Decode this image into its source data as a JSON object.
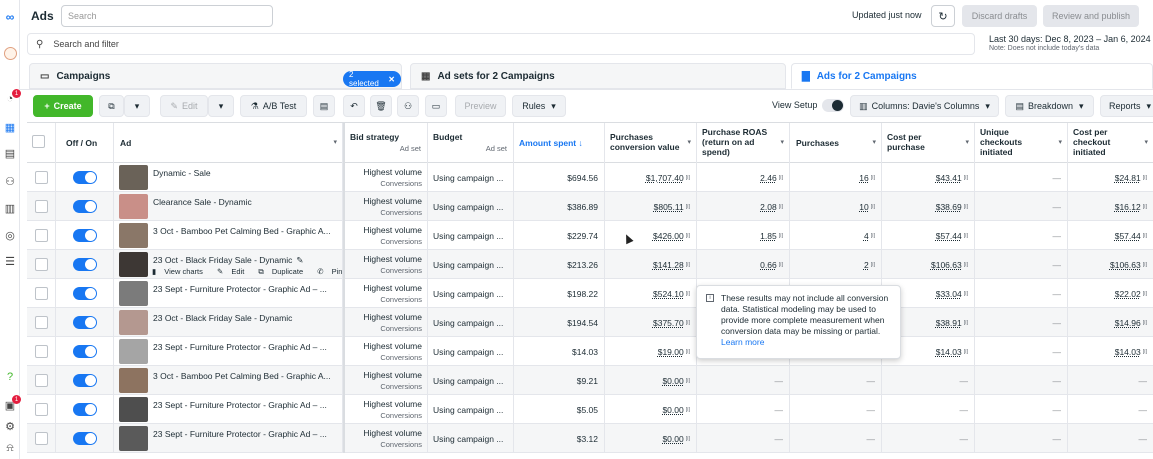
{
  "app": {
    "title": "Ads",
    "search_placeholder": "Search"
  },
  "rail": {
    "badge1": "1",
    "badge2": "1"
  },
  "header": {
    "updated": "Updated just now",
    "discard": "Discard drafts",
    "review": "Review and publish"
  },
  "filter": {
    "placeholder": "Search and filter"
  },
  "daterange": {
    "label": "Last 30 days: Dec 8, 2023 – Jan 6, 2024",
    "note": "Note: Does not include today's data"
  },
  "tabs": {
    "campaigns": "Campaigns",
    "selected_chip": "2 selected",
    "adsets": "Ad sets for 2 Campaigns",
    "ads": "Ads for 2 Campaigns"
  },
  "toolbar": {
    "create": "Create",
    "edit": "Edit",
    "abtest": "A/B Test",
    "preview": "Preview",
    "rules": "Rules",
    "view_setup": "View Setup",
    "columns": "Columns: Davie's Columns",
    "breakdown": "Breakdown",
    "reports": "Reports"
  },
  "columns": {
    "offon": "Off / On",
    "ad": "Ad",
    "bid": "Bid strategy",
    "bid_sub": "Ad set",
    "budget": "Budget",
    "budget_sub": "Ad set",
    "amount": "Amount spent ↓",
    "pcv": "Purchases conversion value",
    "roas": "Purchase ROAS (return on ad spend)",
    "purchases": "Purchases",
    "cpp": "Cost per purchase",
    "uci": "Unique checkouts initiated",
    "cpci": "Cost per checkout initiated"
  },
  "rows": [
    {
      "name": "Dynamic - Sale",
      "bid": "Highest volume",
      "bid_sub": "Conversions",
      "budget": "Using campaign ...",
      "amount": "$694.56",
      "pcv": "$1,707.40",
      "roas": "2.46",
      "purchases": "16",
      "cpp": "$43.41",
      "uci": "—",
      "cpci": "$24.81",
      "thumb": "#6a6258"
    },
    {
      "name": "Clearance Sale - Dynamic",
      "bid": "Highest volume",
      "bid_sub": "Conversions",
      "budget": "Using campaign ...",
      "amount": "$386.89",
      "pcv": "$805.11",
      "roas": "2.08",
      "purchases": "10",
      "cpp": "$38.69",
      "uci": "—",
      "cpci": "$16.12",
      "thumb": "#c98f88"
    },
    {
      "name": "3 Oct - Bamboo Pet Calming Bed - Graphic A...",
      "bid": "Highest volume",
      "bid_sub": "Conversions",
      "budget": "Using campaign ...",
      "amount": "$229.74",
      "pcv": "$426.00",
      "roas": "1.85",
      "purchases": "4",
      "cpp": "$57.44",
      "uci": "—",
      "cpci": "$57.44",
      "thumb": "#8a7768"
    },
    {
      "name": "23 Oct - Black Friday Sale - Dynamic",
      "bid": "Highest volume",
      "bid_sub": "Conversions",
      "budget": "Using campaign ...",
      "amount": "$213.26",
      "pcv": "$141.28",
      "roas": "0.66",
      "purchases": "2",
      "cpp": "$106.63",
      "uci": "—",
      "cpci": "$106.63",
      "thumb": "#3d3734"
    },
    {
      "name": "23 Sept - Furniture Protector - Graphic Ad – ...",
      "bid": "Highest volume",
      "bid_sub": "Conversions",
      "budget": "Using campaign ...",
      "amount": "$198.22",
      "pcv": "$524.10",
      "roas": "",
      "purchases": "",
      "cpp": "$33.04",
      "uci": "—",
      "cpci": "$22.02",
      "thumb": "#7b7b7b"
    },
    {
      "name": "23 Oct - Black Friday Sale - Dynamic",
      "bid": "Highest volume",
      "bid_sub": "Conversions",
      "budget": "Using campaign ...",
      "amount": "$194.54",
      "pcv": "$375.70",
      "roas": "",
      "purchases": "",
      "cpp": "$38.91",
      "uci": "—",
      "cpci": "$14.96",
      "thumb": "#b49890"
    },
    {
      "name": "23 Sept - Furniture Protector - Graphic Ad – ...",
      "bid": "Highest volume",
      "bid_sub": "Conversions",
      "budget": "Using campaign ...",
      "amount": "$14.03",
      "pcv": "$19.00",
      "roas": "",
      "purchases": "",
      "cpp": "$14.03",
      "uci": "—",
      "cpci": "$14.03",
      "thumb": "#a5a5a5"
    },
    {
      "name": "3 Oct - Bamboo Pet Calming Bed - Graphic A...",
      "bid": "Highest volume",
      "bid_sub": "Conversions",
      "budget": "Using campaign ...",
      "amount": "$9.21",
      "pcv": "$0.00",
      "roas": "—",
      "purchases": "—",
      "cpp": "—",
      "uci": "—",
      "cpci": "—",
      "thumb": "#8d7360"
    },
    {
      "name": "23 Sept - Furniture Protector - Graphic Ad – ...",
      "bid": "Highest volume",
      "bid_sub": "Conversions",
      "budget": "Using campaign ...",
      "amount": "$5.05",
      "pcv": "$0.00",
      "roas": "—",
      "purchases": "—",
      "cpp": "—",
      "uci": "—",
      "cpci": "—",
      "thumb": "#4e4e4e"
    },
    {
      "name": "23 Sept - Furniture Protector - Graphic Ad – ...",
      "bid": "Highest volume",
      "bid_sub": "Conversions",
      "budget": "Using campaign ...",
      "amount": "$3.12",
      "pcv": "$0.00",
      "roas": "—",
      "purchases": "—",
      "cpp": "—",
      "uci": "—",
      "cpci": "—",
      "thumb": "#5a5a5a"
    }
  ],
  "row_actions": {
    "view_charts": "View charts",
    "edit": "Edit",
    "duplicate": "Duplicate",
    "pin": "Pin"
  },
  "tooltip": {
    "text": "These results may not include all conversion data. Statistical modeling may be used to provide more complete measurement when conversion data may be missing or partial.",
    "link": "Learn more"
  }
}
